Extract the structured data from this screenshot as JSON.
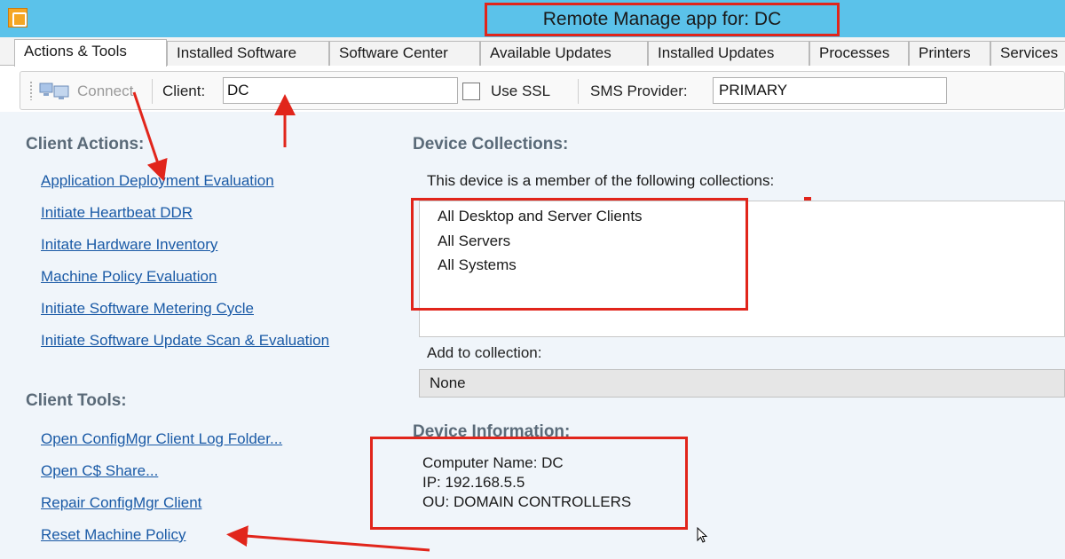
{
  "window": {
    "title": "Remote Manage app for: DC",
    "icon": "app-icon"
  },
  "tabs": [
    {
      "label": "Actions & Tools"
    },
    {
      "label": "Installed Software"
    },
    {
      "label": "Software Center"
    },
    {
      "label": "Available Updates"
    },
    {
      "label": "Installed Updates"
    },
    {
      "label": "Processes"
    },
    {
      "label": "Printers"
    },
    {
      "label": "Services"
    }
  ],
  "toolbar": {
    "connect_label": "Connect",
    "connect_icon": "computer-connect-icon",
    "client_label": "Client:",
    "client_value": "DC",
    "use_ssl_label": "Use SSL",
    "use_ssl_checked": false,
    "sms_provider_label": "SMS Provider:",
    "sms_provider_value": "PRIMARY"
  },
  "client_actions": {
    "title": "Client Actions:",
    "links": [
      "Application Deployment Evaluation",
      "Initiate Heartbeat DDR",
      "Initate Hardware Inventory",
      "Machine Policy Evaluation",
      "Initiate Software Metering Cycle",
      "Initiate Software Update Scan & Evaluation"
    ]
  },
  "client_tools": {
    "title": "Client Tools:",
    "links": [
      "Open ConfigMgr Client Log Folder...",
      "Open C$ Share...",
      "Repair ConfigMgr Client",
      "Reset Machine Policy"
    ]
  },
  "device_collections": {
    "title": "Device Collections:",
    "member_text": "This device is a member of the following collections:",
    "items": [
      "All Desktop and Server Clients",
      "All Servers",
      "All Systems"
    ],
    "add_label": "Add to collection:",
    "add_value": "None"
  },
  "device_information": {
    "title": "Device Information:",
    "computer_name": "Computer Name: DC",
    "ip": "IP: 192.168.5.5",
    "ou": "OU: DOMAIN CONTROLLERS"
  },
  "colors": {
    "titlebar": "#5bc2ea",
    "annotation_red": "#e1251b",
    "link": "#1a5aa6",
    "section_title": "#5a6a78"
  }
}
